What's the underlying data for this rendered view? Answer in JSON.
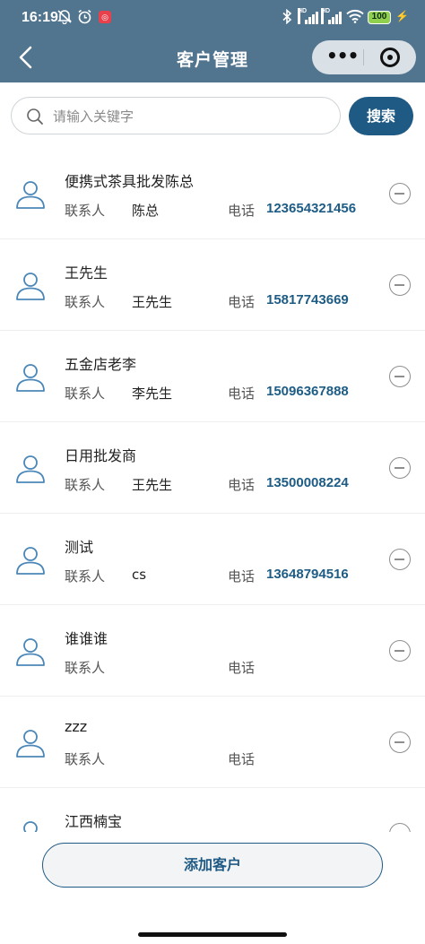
{
  "status_bar": {
    "time": "16:19",
    "battery": "100"
  },
  "nav": {
    "title": "客户管理"
  },
  "search": {
    "placeholder": "请输入关键字",
    "value": "",
    "button": "搜索"
  },
  "labels": {
    "contact": "联系人",
    "phone": "电话"
  },
  "customers": [
    {
      "name": "便携式茶具批发陈总",
      "contact": "陈总",
      "phone": "123654321456"
    },
    {
      "name": "王先生",
      "contact": "王先生",
      "phone": "15817743669"
    },
    {
      "name": "五金店老李",
      "contact": "李先生",
      "phone": "15096367888"
    },
    {
      "name": "日用批发商",
      "contact": "王先生",
      "phone": "13500008224"
    },
    {
      "name": "测试",
      "contact": "cs",
      "phone": "13648794516"
    },
    {
      "name": "谁谁谁",
      "contact": "",
      "phone": ""
    },
    {
      "name": "zzz",
      "contact": "",
      "phone": ""
    },
    {
      "name": "江西楠宝",
      "contact": "",
      "phone": ""
    }
  ],
  "add_button": "添加客户",
  "colors": {
    "header": "#51748f",
    "accent": "#1f5a84",
    "phone": "#1d5c85"
  }
}
